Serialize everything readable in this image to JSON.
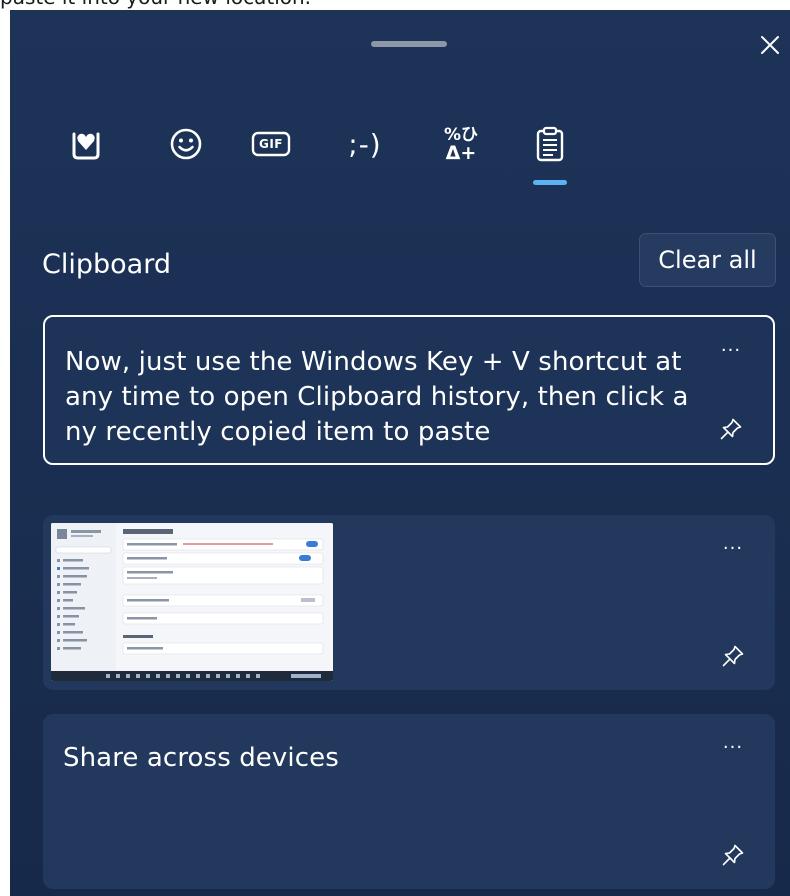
{
  "page_caption": "paste it into your new location.",
  "panel": {
    "tabs": [
      {
        "name": "favorites",
        "icon": "heart-square-icon"
      },
      {
        "name": "emoji",
        "icon": "smiley-icon"
      },
      {
        "name": "gif",
        "icon": "gif-icon",
        "label": "GIF"
      },
      {
        "name": "kaomoji",
        "icon": "kaomoji-icon",
        "label": ";-)"
      },
      {
        "name": "symbols",
        "icon": "symbols-icon",
        "label_top": "%ひ",
        "label_bottom": "Δ+"
      },
      {
        "name": "clipboard",
        "icon": "clipboard-icon",
        "active": true
      }
    ],
    "section_title": "Clipboard",
    "clear_all_label": "Clear all",
    "items": [
      {
        "text": "Now, just use the Windows Key + V shortcut at any time to open Clipboard history, then click any recently copied item to paste",
        "selected": true
      },
      {
        "kind": "image-thumbnail"
      },
      {
        "text": "Share across devices"
      }
    ],
    "more_label": "···"
  },
  "colors": {
    "panel_bg": "#1b3054",
    "card_bg": "#22385c",
    "accent": "#5fb2f2",
    "text": "#ffffff"
  }
}
